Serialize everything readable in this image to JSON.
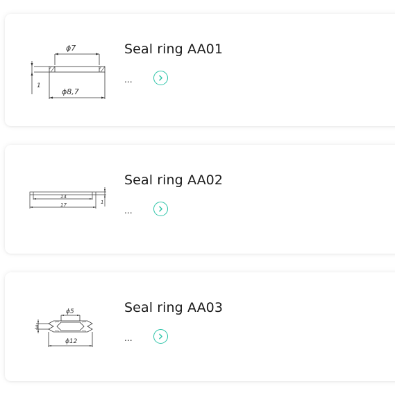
{
  "accent_color": "#2cc4a8",
  "products": [
    {
      "title": "Seal ring AA01",
      "description": "...",
      "more_icon": "chevron-right-circle-icon",
      "drawing": {
        "top_dim": "ϕ7",
        "bottom_dim": "ϕ8,7",
        "side_dim": "1"
      }
    },
    {
      "title": "Seal ring AA02",
      "description": "...",
      "more_icon": "chevron-right-circle-icon",
      "drawing": {
        "top_dim": "14",
        "bottom_dim": "17",
        "side_dim": "1"
      }
    },
    {
      "title": "Seal ring AA03",
      "description": "...",
      "more_icon": "chevron-right-circle-icon",
      "drawing": {
        "top_dim": "ϕ5",
        "bottom_dim": "ϕ12",
        "side_dim": "3"
      }
    }
  ]
}
